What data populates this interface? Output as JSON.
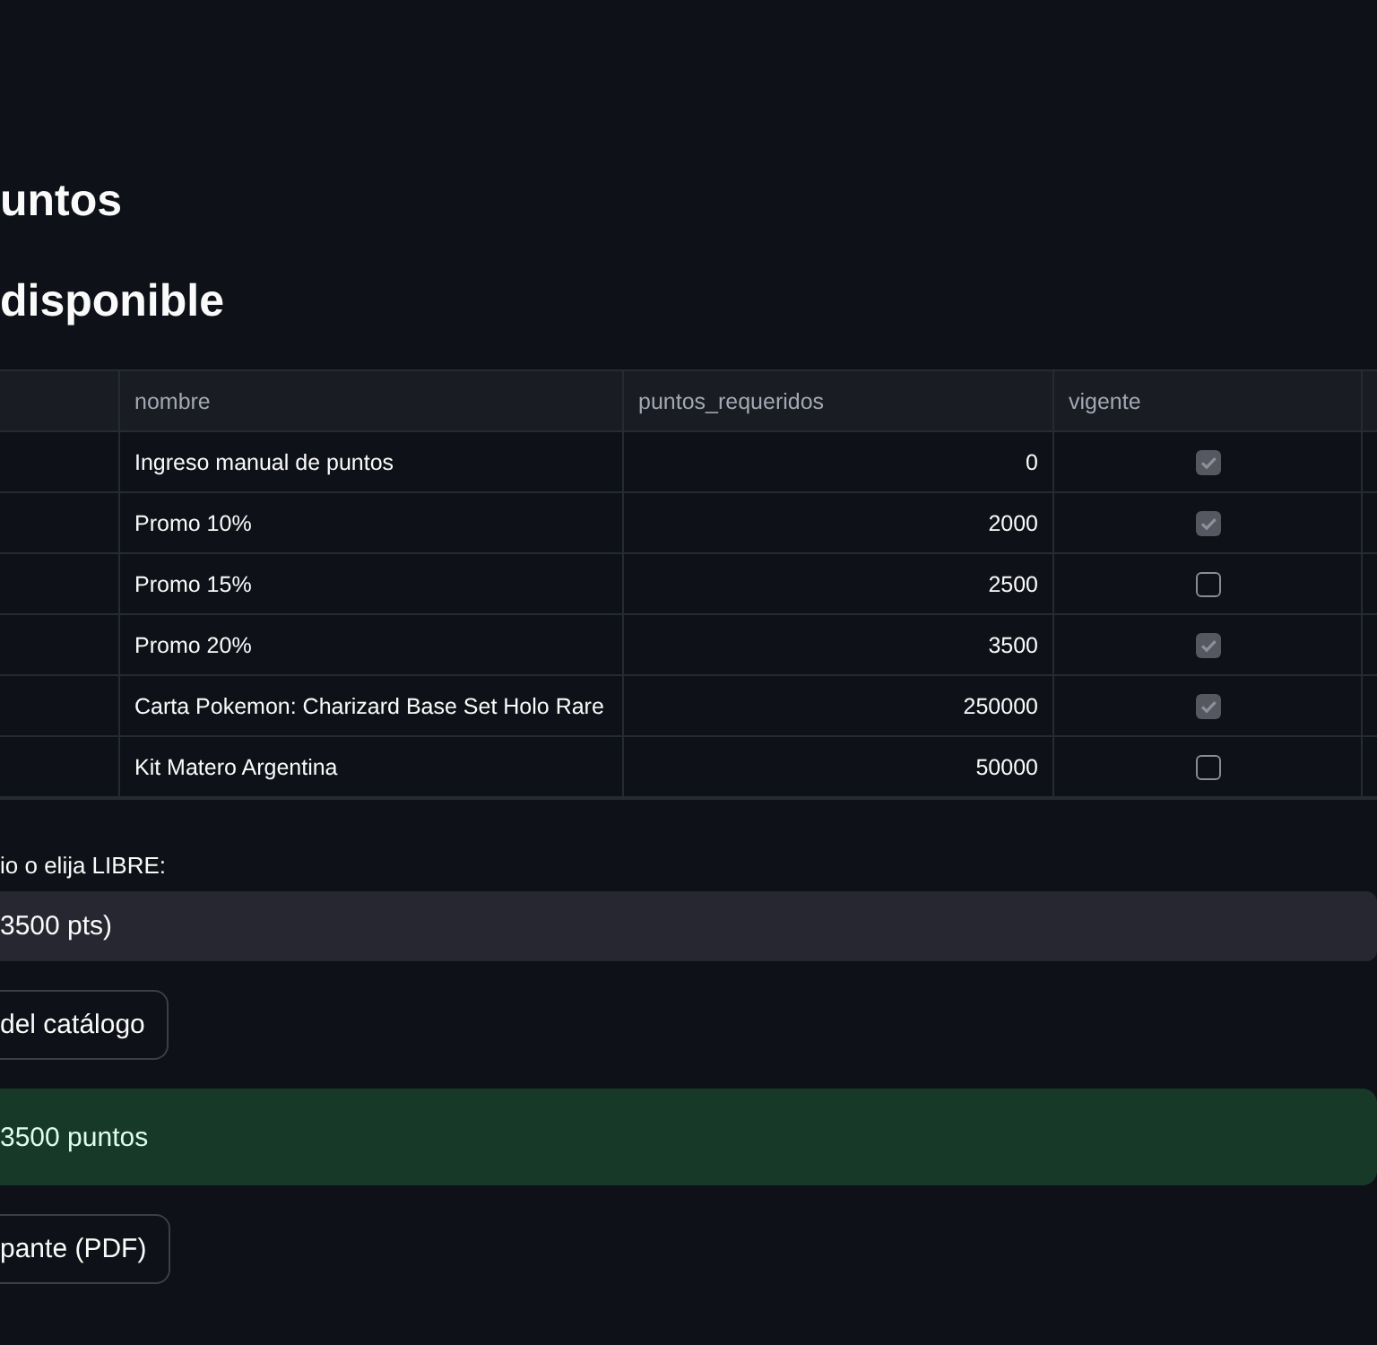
{
  "headings": [
    {
      "text": "untos"
    },
    {
      "text": "disponible"
    }
  ],
  "table": {
    "columns": [
      "nombre",
      "puntos_requeridos",
      "vigente"
    ],
    "rows": [
      {
        "nombre": "Ingreso manual de puntos",
        "puntos_requeridos": "0",
        "vigente": true
      },
      {
        "nombre": "Promo 10%",
        "puntos_requeridos": "2000",
        "vigente": true
      },
      {
        "nombre": "Promo 15%",
        "puntos_requeridos": "2500",
        "vigente": false
      },
      {
        "nombre": "Promo 20%",
        "puntos_requeridos": "3500",
        "vigente": true
      },
      {
        "nombre": "Carta Pokemon: Charizard Base Set Holo Rare",
        "puntos_requeridos": "250000",
        "vigente": true
      },
      {
        "nombre": "Kit Matero Argentina",
        "puntos_requeridos": "50000",
        "vigente": false
      }
    ]
  },
  "select": {
    "label": "io o elija LIBRE:",
    "value": "3500 pts)"
  },
  "buttons": [
    {
      "label": "del catálogo"
    }
  ],
  "success": {
    "text": "3500 puntos"
  },
  "download_button": {
    "label": "pante (PDF)"
  }
}
